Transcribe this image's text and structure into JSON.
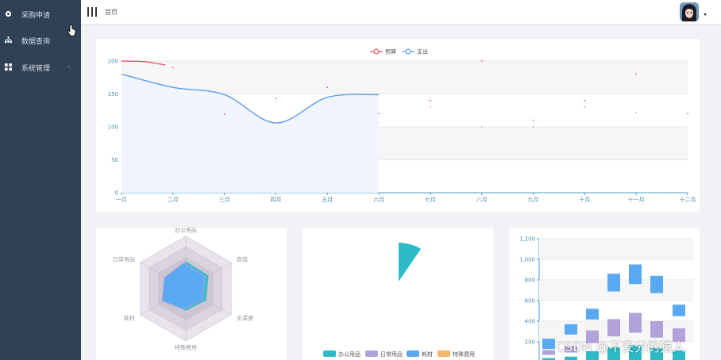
{
  "sidebar": {
    "items": [
      {
        "label": "采购申请",
        "icon": "gear-icon",
        "expandable": false
      },
      {
        "label": "数据查询",
        "icon": "tree-icon",
        "expandable": false
      },
      {
        "label": "系统管理",
        "icon": "grid-icon",
        "expandable": true,
        "arrow": "⌄"
      }
    ]
  },
  "header": {
    "breadcrumb": "首页",
    "menu_icon": "hamburger-icon",
    "avatar_icon": "avatar-icon"
  },
  "watermark": "CSDN @不安分的猿人",
  "colors": {
    "sidebar_bg": "#304156",
    "budget": "#e8536b",
    "expense": "#5b9bf0",
    "office": "#2cbac6",
    "daily": "#b2a2dc",
    "material": "#58a9f2",
    "special": "#f5b36b"
  },
  "chart_data": [
    {
      "type": "line",
      "legend": [
        "预算",
        "支出"
      ],
      "legend_placement": "top-center",
      "categories": [
        "一月",
        "二月",
        "三月",
        "四月",
        "五月",
        "六月",
        "七月",
        "八月",
        "九月",
        "十月",
        "十一月",
        "十二月"
      ],
      "series": [
        {
          "name": "预算",
          "values": [
            200,
            190,
            119,
            143,
            160,
            120,
            140,
            200,
            110,
            140,
            180,
            120
          ]
        },
        {
          "name": "支出",
          "values": [
            180,
            160,
            149,
            106,
            145,
            149,
            130,
            100,
            100,
            130,
            122,
            120
          ]
        }
      ],
      "ylim": [
        0,
        200
      ],
      "yticks": [
        "0",
        "50",
        "100",
        "150",
        "200"
      ]
    },
    {
      "type": "radar",
      "indicators": [
        "办公用品",
        "宾馆",
        "出差费",
        "特殊费用",
        "耗材",
        "日常用品"
      ],
      "series": [
        {
          "values": [
            0.52,
            0.5,
            0.45,
            0.42,
            0.5,
            0.45
          ]
        }
      ]
    },
    {
      "type": "pie",
      "legend": [
        "办公用品",
        "日常用品",
        "耗材",
        "特殊费用"
      ],
      "legend_placement": "bottom",
      "values": [
        1,
        0,
        0,
        0
      ]
    },
    {
      "type": "bar",
      "ylim": [
        0,
        1200
      ],
      "yticks": [
        "200",
        "400",
        "600",
        "800",
        "1,000",
        "1,200"
      ],
      "series": [
        {
          "name": "日常用品",
          "values": [
            120,
            160,
            310,
            420,
            480,
            400,
            330
          ]
        },
        {
          "name": "耗材",
          "values": [
            230,
            370,
            520,
            860,
            950,
            840,
            560
          ]
        }
      ]
    }
  ]
}
